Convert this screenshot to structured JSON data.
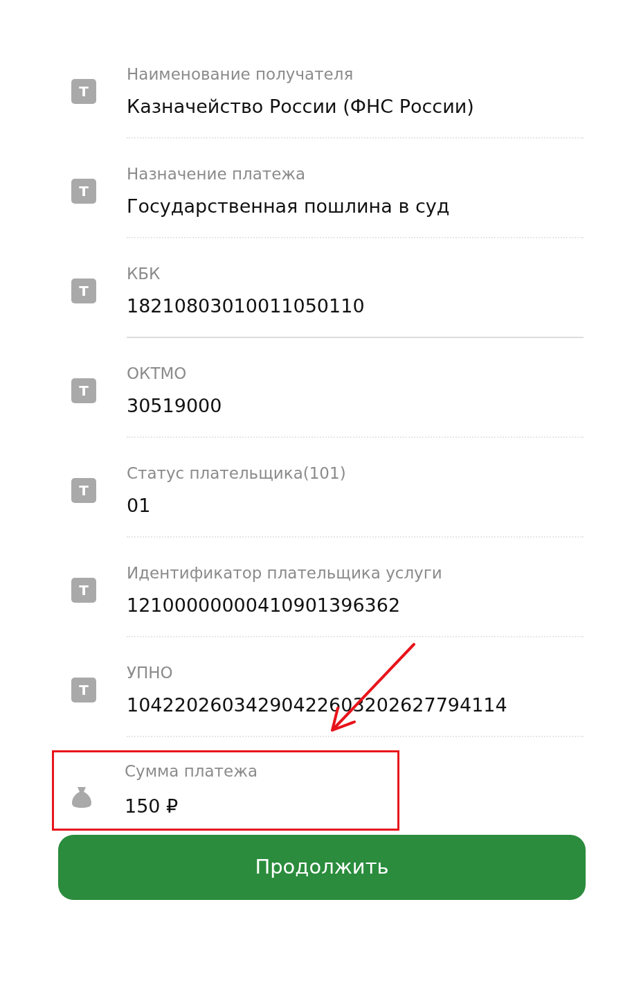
{
  "fields": [
    {
      "kind": "text",
      "icon_letter": "Т",
      "label": "Наименование получателя",
      "value": "Казначейство России (ФНС России)",
      "divider": true,
      "divider_solid": false,
      "highlighted": false
    },
    {
      "kind": "text",
      "icon_letter": "Т",
      "label": "Назначение платежа",
      "value": "Государственная пошлина в суд",
      "divider": true,
      "divider_solid": false,
      "highlighted": false
    },
    {
      "kind": "text",
      "icon_letter": "Т",
      "label": "КБК",
      "value": "18210803010011050110",
      "divider": true,
      "divider_solid": true,
      "highlighted": false
    },
    {
      "kind": "text",
      "icon_letter": "Т",
      "label": "ОКТМО",
      "value": "30519000",
      "divider": true,
      "divider_solid": false,
      "highlighted": false
    },
    {
      "kind": "text",
      "icon_letter": "Т",
      "label": "Статус плательщика(101)",
      "value": "01",
      "divider": true,
      "divider_solid": false,
      "highlighted": false
    },
    {
      "kind": "text",
      "icon_letter": "Т",
      "label": "Идентификатор плательщика услуги",
      "value": "12100000000410901396362",
      "divider": true,
      "divider_solid": false,
      "highlighted": false
    },
    {
      "kind": "text",
      "icon_letter": "Т",
      "label": "УПНО",
      "value": "10422026034290422603202627794114",
      "divider": true,
      "divider_solid": false,
      "highlighted": false
    },
    {
      "kind": "money",
      "label": "Сумма платежа",
      "value": "150 ₽",
      "divider": false,
      "highlighted": true
    }
  ],
  "continue_button": "Продолжить"
}
